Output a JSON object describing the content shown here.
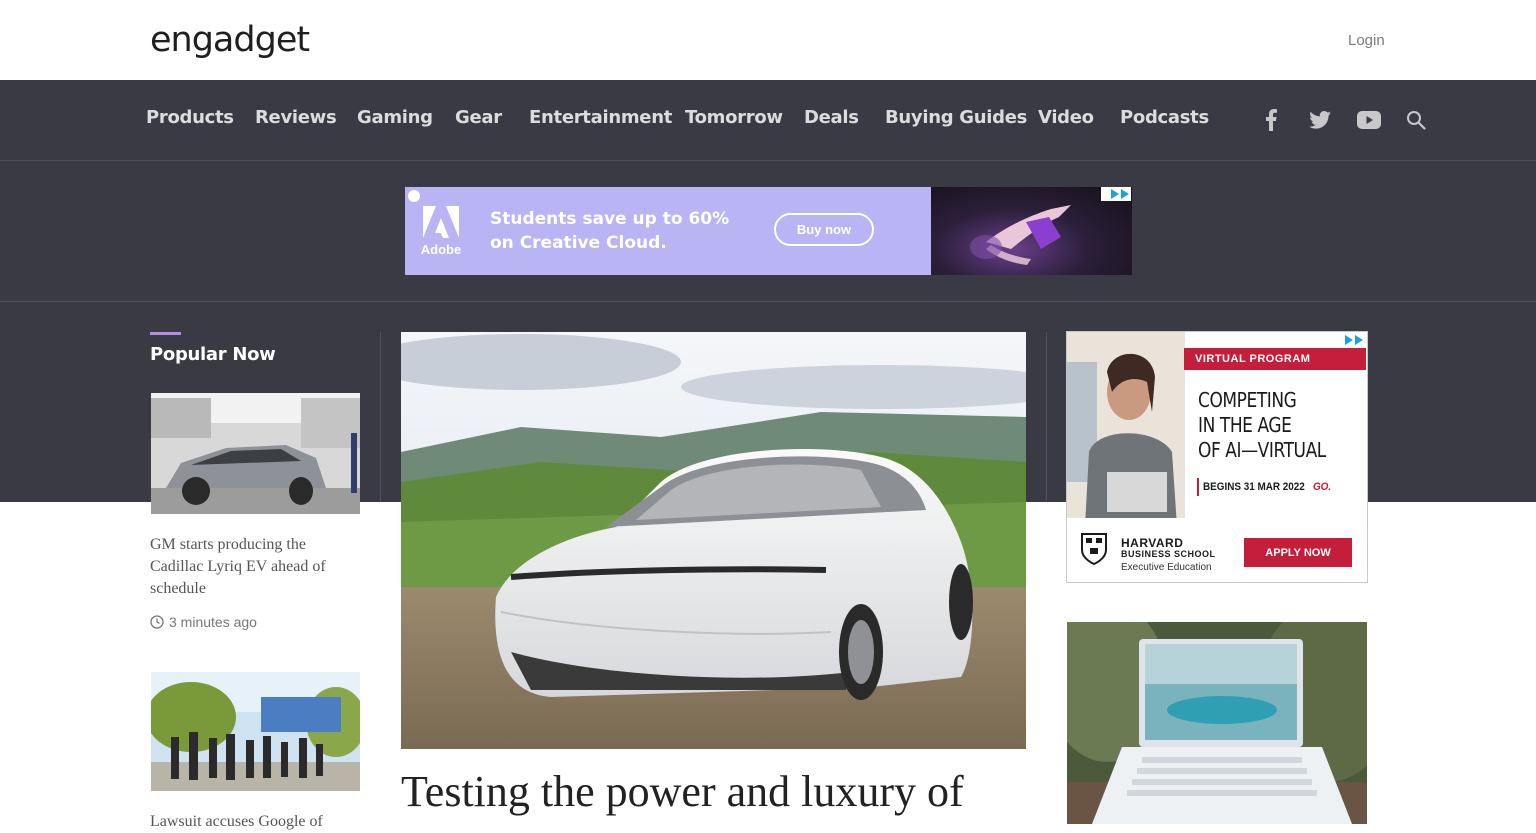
{
  "header": {
    "logo": "engadget",
    "login": "Login"
  },
  "nav": {
    "items": [
      "Products",
      "Reviews",
      "Gaming",
      "Gear",
      "Entertainment",
      "Tomorrow",
      "Deals",
      "Buying Guides",
      "Video",
      "Podcasts"
    ],
    "social_icons": [
      "facebook-icon",
      "twitter-icon",
      "youtube-icon",
      "search-icon"
    ]
  },
  "top_ad": {
    "brand": "Adobe",
    "line1": "Students save up to 60%",
    "line2": "on Creative Cloud.",
    "cta": "Buy now"
  },
  "sidebar": {
    "title": "Popular Now",
    "articles": [
      {
        "headline": "GM starts producing the Cadillac Lyriq EV ahead of schedule",
        "time": "3 minutes ago"
      },
      {
        "headline": "Lawsuit accuses Google of"
      }
    ]
  },
  "hero": {
    "title": "Testing the power and luxury of"
  },
  "side_ad": {
    "tag": "VIRTUAL PROGRAM",
    "line1": "COMPETING",
    "line2": "IN THE AGE",
    "line3": "OF AI—VIRTUAL",
    "begins": "BEGINS 31 MAR 2022",
    "go": "GO.",
    "school1": "HARVARD",
    "school2": "BUSINESS SCHOOL",
    "school3": "Executive Education",
    "cta": "APPLY NOW"
  },
  "colors": {
    "nav_bg": "#3a3a45",
    "accent": "#b48ce6",
    "ad_purple": "#b9b4f3",
    "harvard_red": "#c41e3a"
  }
}
